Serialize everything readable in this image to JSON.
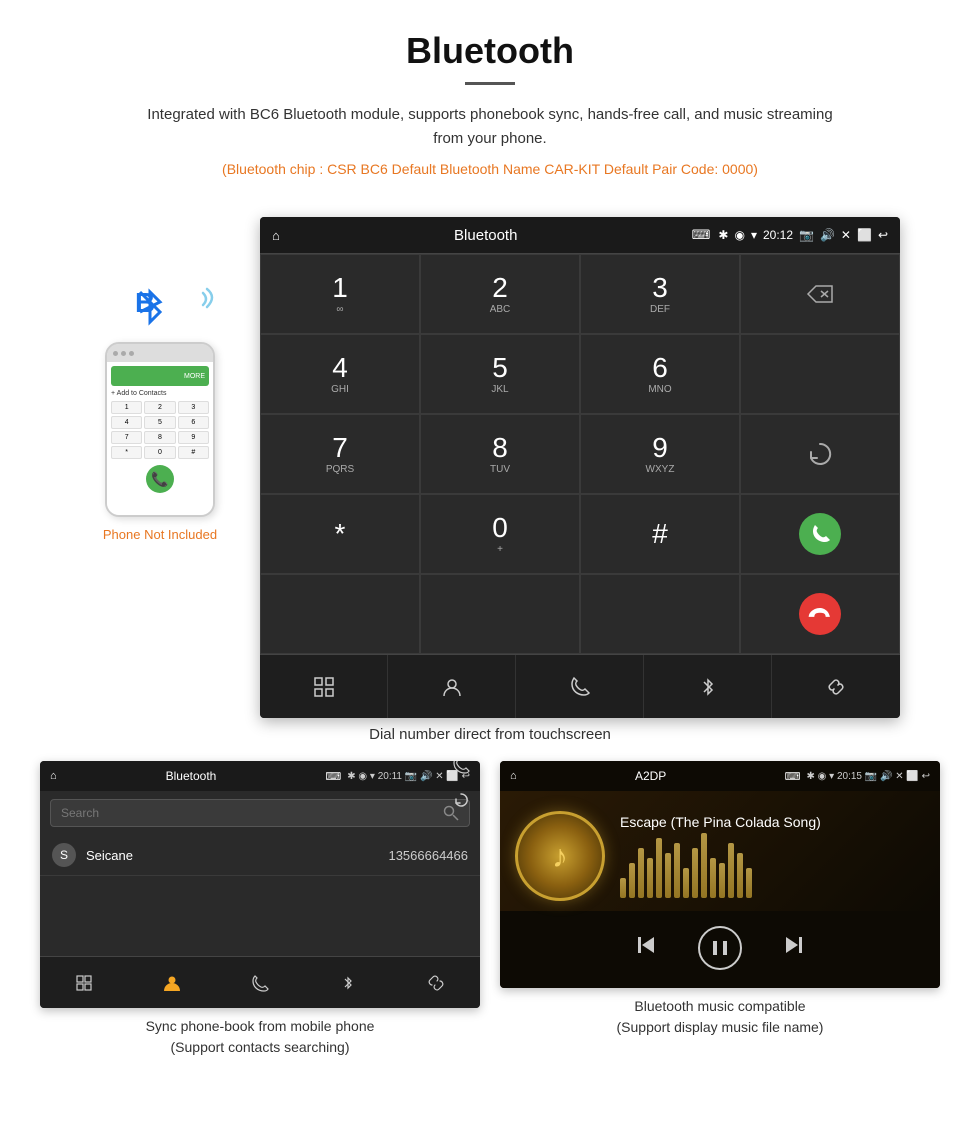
{
  "page": {
    "title": "Bluetooth",
    "description": "Integrated with BC6 Bluetooth module, supports phonebook sync, hands-free call, and music streaming from your phone.",
    "spec_line": "(Bluetooth chip : CSR BC6    Default Bluetooth Name CAR-KIT    Default Pair Code: 0000)",
    "main_caption": "Dial number direct from touchscreen",
    "phone_not_included": "Phone Not Included"
  },
  "dial_screen": {
    "status": {
      "title": "Bluetooth",
      "time": "20:12",
      "usb_icon": "⌨",
      "bt_icon": "✱",
      "location_icon": "◉",
      "wifi_icon": "▾",
      "camera_icon": "📷",
      "volume_icon": "🔊",
      "close_icon": "✕",
      "window_icon": "⬜",
      "back_icon": "↩"
    },
    "keys": [
      {
        "num": "1",
        "sub": "∞"
      },
      {
        "num": "2",
        "sub": "ABC"
      },
      {
        "num": "3",
        "sub": "DEF"
      },
      {
        "num": "backspace",
        "sub": ""
      },
      {
        "num": "4",
        "sub": "GHI"
      },
      {
        "num": "5",
        "sub": "JKL"
      },
      {
        "num": "6",
        "sub": "MNO"
      },
      {
        "num": "empty",
        "sub": ""
      },
      {
        "num": "7",
        "sub": "PQRS"
      },
      {
        "num": "8",
        "sub": "TUV"
      },
      {
        "num": "9",
        "sub": "WXYZ"
      },
      {
        "num": "refresh",
        "sub": ""
      },
      {
        "num": "*",
        "sub": ""
      },
      {
        "num": "0",
        "sub": "+"
      },
      {
        "num": "#",
        "sub": ""
      },
      {
        "num": "call_green",
        "sub": ""
      },
      {
        "num": "empty2",
        "sub": ""
      },
      {
        "num": "empty3",
        "sub": ""
      },
      {
        "num": "empty4",
        "sub": ""
      },
      {
        "num": "call_red",
        "sub": ""
      }
    ],
    "toolbar": [
      "⊞",
      "👤",
      "📞",
      "✱",
      "🔗"
    ]
  },
  "phonebook_screen": {
    "status": {
      "home": "⌂",
      "title": "Bluetooth",
      "usb": "⌨",
      "icons": "✱ ◉ ▾ 20:11 📷 🔊 ✕ ⬜ ↩"
    },
    "search_placeholder": "Search",
    "contacts": [
      {
        "initial": "S",
        "name": "Seicane",
        "number": "13566664466"
      }
    ],
    "toolbar": [
      "⊞",
      "👤",
      "📞",
      "✱",
      "🔗"
    ],
    "caption_line1": "Sync phone-book from mobile phone",
    "caption_line2": "(Support contacts searching)"
  },
  "music_screen": {
    "status": {
      "home": "⌂",
      "title": "A2DP",
      "usb": "⌨",
      "time": "20:15",
      "icons": "✱ ◉ ▾ 20:15 📷 🔊 ✕ ⬜ ↩"
    },
    "song_title": "Escape (The Pina Colada Song)",
    "visualizer_bars": [
      20,
      35,
      50,
      40,
      60,
      45,
      55,
      30,
      50,
      65,
      40,
      35,
      55,
      45,
      30
    ],
    "controls": {
      "prev": "⏮",
      "play_pause": "⏸",
      "next": "⏭"
    },
    "caption_line1": "Bluetooth music compatible",
    "caption_line2": "(Support display music file name)"
  },
  "phone_mockup": {
    "keys": [
      "1",
      "2",
      "3",
      "4",
      "5",
      "6",
      "7",
      "8",
      "9",
      "*",
      "0",
      "#"
    ]
  }
}
